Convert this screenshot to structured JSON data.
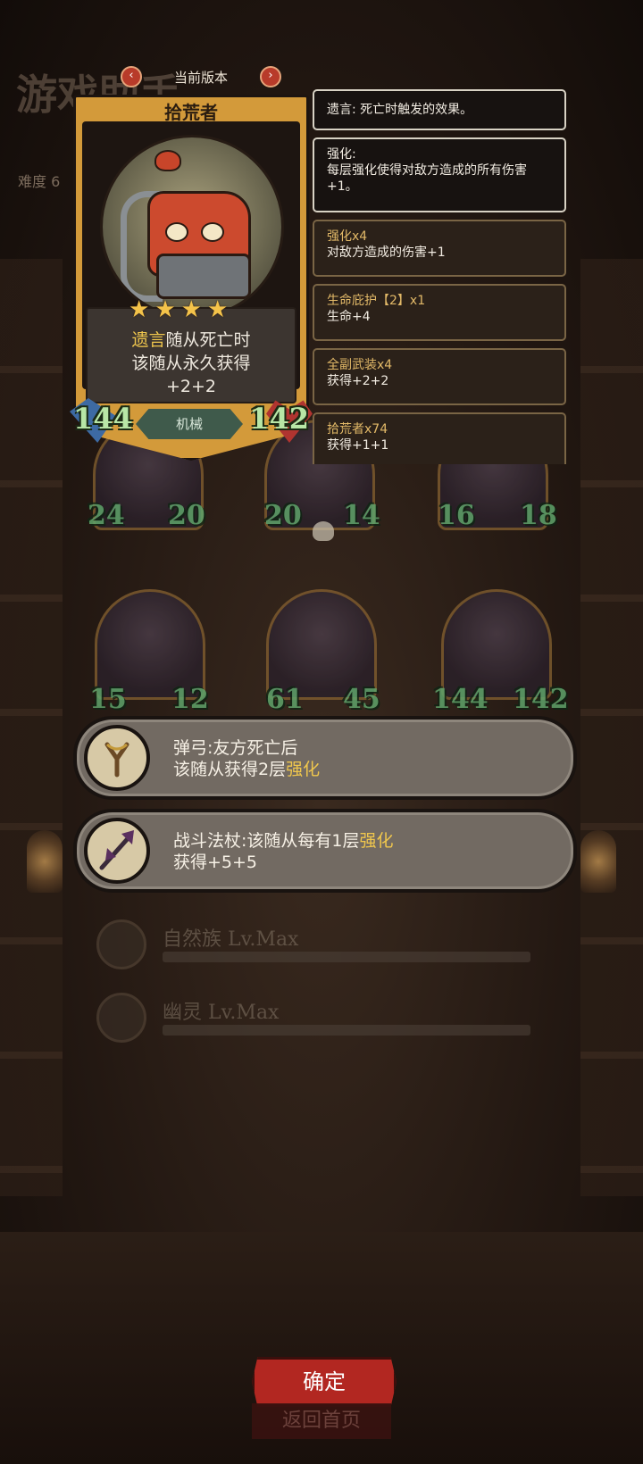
{
  "background": {
    "title": "游戏助手",
    "difficulty_label": "难度 6"
  },
  "version": {
    "label": "当前版本"
  },
  "card": {
    "name": "拾荒者",
    "tribe": "机械",
    "attack": "144",
    "health": "142",
    "star_count": 4,
    "text_keyword": "遗言",
    "text_line1_rest": "随从死亡时",
    "text_line2": "该随从永久获得",
    "text_line3": "+2+2"
  },
  "tooltips": [
    {
      "title": "",
      "body": "遗言: 死亡时触发的效果。"
    },
    {
      "title": "强化:",
      "body": "每层强化使得对敌方造成的所有伤害+1。"
    },
    {
      "title": "强化x4",
      "body": "对敌方造成的伤害+1"
    },
    {
      "title": "生命庇护【2】x1",
      "body": "生命+4"
    },
    {
      "title": "全副武装x4",
      "body": "获得+2+2"
    },
    {
      "title": "拾荒者x74",
      "body": "获得+1+1"
    }
  ],
  "board": {
    "row1": [
      {
        "atk": "24",
        "hp": "20"
      },
      {
        "atk": "20",
        "hp": "14"
      },
      {
        "atk": "16",
        "hp": "18"
      }
    ],
    "row2": [
      {
        "atk": "15",
        "hp": "12"
      },
      {
        "atk": "61",
        "hp": "45"
      },
      {
        "atk": "144",
        "hp": "142"
      }
    ]
  },
  "equipment": [
    {
      "line1": "弹弓:友方死亡后",
      "line2_pre": "该随从获得2层",
      "line2_hl": "强化",
      "icon": "slingshot-icon"
    },
    {
      "line1_pre": "战斗法杖:该随从每有1层",
      "line1_hl": "强化",
      "line2": "获得+5+5",
      "icon": "battle-staff-icon"
    }
  ],
  "tribes": [
    {
      "name": "自然族 Lv.Max",
      "icon": "nature-tribe-icon"
    },
    {
      "name": "幽灵 Lv.Max",
      "icon": "ghost-tribe-icon"
    }
  ],
  "buttons": {
    "confirm": "确定",
    "home": "返回首页"
  },
  "colors": {
    "highlight": "#efc64d",
    "confirm_red": "#b22721",
    "card_gold": "#d39a3a"
  }
}
